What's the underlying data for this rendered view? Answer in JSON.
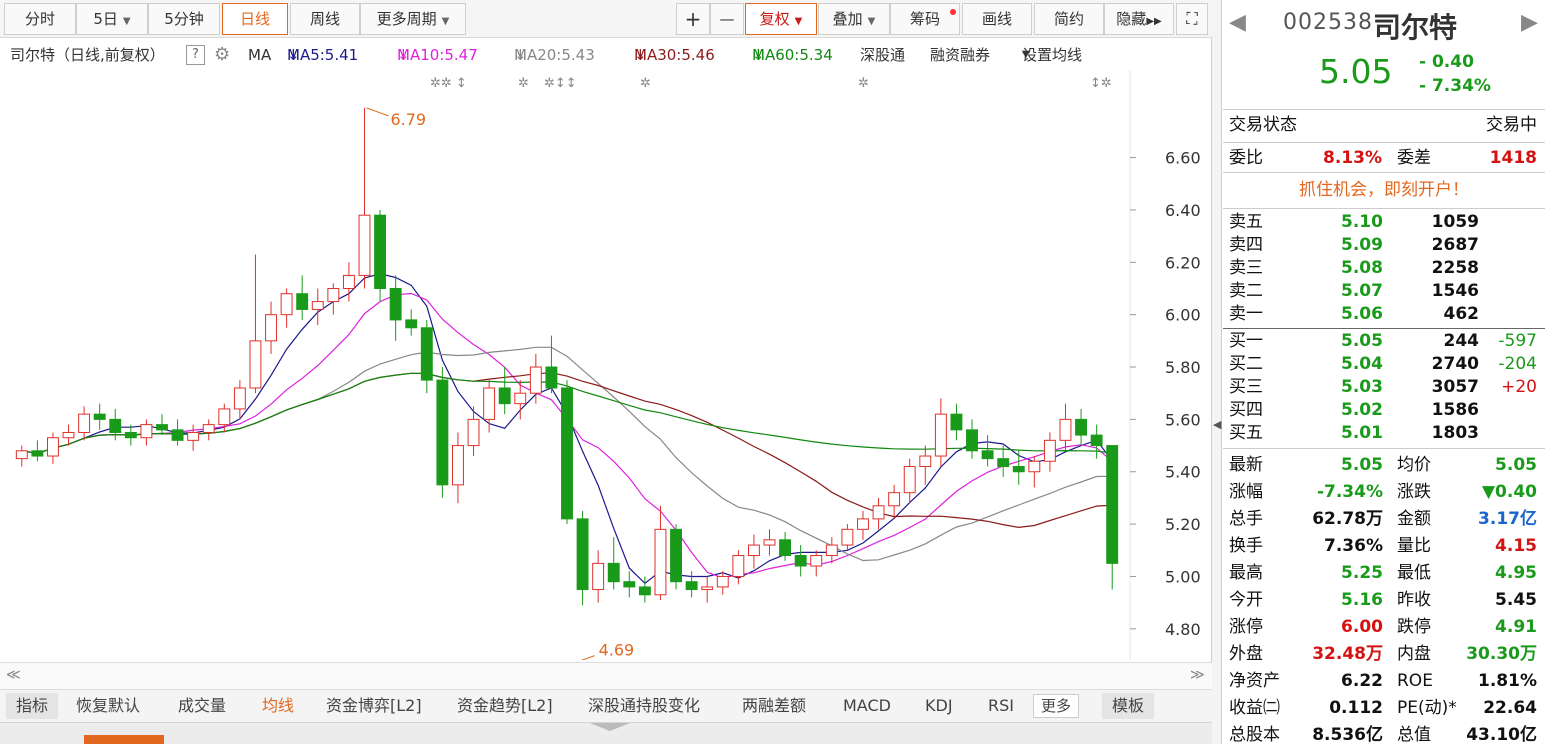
{
  "toolbar": {
    "fenshi": "分时",
    "day5": "5日",
    "min5": "5分钟",
    "rixian": "日线",
    "zhouxian": "周线",
    "more_period": "更多周期",
    "plus": "+",
    "minus": "—",
    "fuquan": "复权",
    "diejia": "叠加",
    "chouma": "筹码",
    "huaxian": "画线",
    "jianyue": "简约",
    "yincang": "隐藏",
    "expand": "⛶"
  },
  "ma_bar": {
    "title": "司尔特（日线,前复权）",
    "help": "?",
    "ma_label": "MA",
    "ma5": "MA5:5.41",
    "ma10": "MA10:5.47",
    "ma20": "MA20:5.43",
    "ma30": "MA30:5.46",
    "ma60": "MA60:5.34",
    "arrow": "↓",
    "shgt": "深股通",
    "rzrq": "融资融券",
    "set_ma": "设置均线",
    "colors": {
      "ma5": "#1a1a8c",
      "ma10": "#dd22dd",
      "ma20": "#888888",
      "ma30": "#8b1a1a",
      "ma60": "#118811"
    }
  },
  "chart_data": {
    "type": "candlestick",
    "y_ticks": [
      "6.60",
      "6.40",
      "6.20",
      "6.00",
      "5.80",
      "5.60",
      "5.40",
      "5.20",
      "5.00",
      "4.80"
    ],
    "ylim": [
      4.7,
      6.82
    ],
    "high_label": "6.79",
    "low_label": "4.69",
    "s_label": "$",
    "annot": [
      "✲✲ ↕",
      "✲",
      "✲↕↕",
      "✲",
      "✲",
      "↕✲"
    ],
    "ohlc": [
      [
        5.45,
        5.5,
        5.42,
        5.48
      ],
      [
        5.48,
        5.52,
        5.44,
        5.46
      ],
      [
        5.46,
        5.55,
        5.43,
        5.53
      ],
      [
        5.53,
        5.58,
        5.5,
        5.55
      ],
      [
        5.55,
        5.65,
        5.52,
        5.62
      ],
      [
        5.62,
        5.66,
        5.56,
        5.6
      ],
      [
        5.6,
        5.64,
        5.52,
        5.55
      ],
      [
        5.55,
        5.58,
        5.5,
        5.53
      ],
      [
        5.53,
        5.6,
        5.5,
        5.58
      ],
      [
        5.58,
        5.62,
        5.54,
        5.56
      ],
      [
        5.56,
        5.6,
        5.5,
        5.52
      ],
      [
        5.52,
        5.58,
        5.48,
        5.55
      ],
      [
        5.55,
        5.6,
        5.52,
        5.58
      ],
      [
        5.58,
        5.66,
        5.55,
        5.64
      ],
      [
        5.64,
        5.75,
        5.6,
        5.72
      ],
      [
        5.72,
        6.23,
        5.7,
        5.9
      ],
      [
        5.9,
        6.05,
        5.85,
        6.0
      ],
      [
        6.0,
        6.1,
        5.95,
        6.08
      ],
      [
        6.08,
        6.15,
        5.98,
        6.02
      ],
      [
        6.02,
        6.1,
        5.96,
        6.05
      ],
      [
        6.05,
        6.12,
        6.0,
        6.1
      ],
      [
        6.1,
        6.2,
        6.05,
        6.15
      ],
      [
        6.15,
        6.79,
        6.1,
        6.38
      ],
      [
        6.38,
        6.4,
        6.05,
        6.1
      ],
      [
        6.1,
        6.15,
        5.9,
        5.98
      ],
      [
        5.98,
        6.02,
        5.92,
        5.95
      ],
      [
        5.95,
        5.98,
        5.7,
        5.75
      ],
      [
        5.75,
        5.8,
        5.3,
        5.35
      ],
      [
        5.35,
        5.55,
        5.28,
        5.5
      ],
      [
        5.5,
        5.65,
        5.46,
        5.6
      ],
      [
        5.6,
        5.75,
        5.55,
        5.72
      ],
      [
        5.72,
        5.8,
        5.62,
        5.66
      ],
      [
        5.66,
        5.75,
        5.6,
        5.7
      ],
      [
        5.7,
        5.85,
        5.66,
        5.8
      ],
      [
        5.8,
        5.92,
        5.7,
        5.72
      ],
      [
        5.72,
        5.75,
        5.2,
        5.22
      ],
      [
        5.22,
        5.25,
        4.89,
        4.95
      ],
      [
        4.95,
        5.1,
        4.9,
        5.05
      ],
      [
        5.05,
        5.15,
        4.95,
        4.98
      ],
      [
        4.98,
        5.02,
        4.92,
        4.96
      ],
      [
        4.96,
        5.0,
        4.9,
        4.93
      ],
      [
        4.93,
        5.27,
        4.91,
        5.18
      ],
      [
        5.18,
        5.2,
        4.95,
        4.98
      ],
      [
        4.98,
        5.02,
        4.92,
        4.95
      ],
      [
        4.95,
        5.0,
        4.9,
        4.96
      ],
      [
        4.96,
        5.02,
        4.93,
        5.0
      ],
      [
        5.0,
        5.1,
        4.97,
        5.08
      ],
      [
        5.08,
        5.16,
        5.03,
        5.12
      ],
      [
        5.12,
        5.18,
        5.08,
        5.14
      ],
      [
        5.14,
        5.17,
        5.06,
        5.08
      ],
      [
        5.08,
        5.12,
        5.0,
        5.04
      ],
      [
        5.04,
        5.1,
        5.0,
        5.08
      ],
      [
        5.08,
        5.15,
        5.05,
        5.12
      ],
      [
        5.12,
        5.2,
        5.1,
        5.18
      ],
      [
        5.18,
        5.25,
        5.14,
        5.22
      ],
      [
        5.22,
        5.3,
        5.18,
        5.27
      ],
      [
        5.27,
        5.35,
        5.22,
        5.32
      ],
      [
        5.32,
        5.45,
        5.28,
        5.42
      ],
      [
        5.42,
        5.5,
        5.35,
        5.46
      ],
      [
        5.46,
        5.68,
        5.42,
        5.62
      ],
      [
        5.62,
        5.66,
        5.52,
        5.56
      ],
      [
        5.56,
        5.6,
        5.45,
        5.48
      ],
      [
        5.48,
        5.54,
        5.42,
        5.45
      ],
      [
        5.45,
        5.5,
        5.38,
        5.42
      ],
      [
        5.42,
        5.48,
        5.35,
        5.4
      ],
      [
        5.4,
        5.46,
        5.34,
        5.44
      ],
      [
        5.44,
        5.55,
        5.4,
        5.52
      ],
      [
        5.52,
        5.66,
        5.48,
        5.6
      ],
      [
        5.6,
        5.64,
        5.5,
        5.54
      ],
      [
        5.54,
        5.58,
        5.45,
        5.5
      ],
      [
        5.5,
        5.25,
        4.95,
        5.05
      ]
    ]
  },
  "scroll": {
    "left": "≪",
    "right": "≫"
  },
  "tabs": {
    "t1": "指标",
    "t2": "恢复默认",
    "t3": "成交量",
    "t4": "均线",
    "t5": "资金博弈[L2]",
    "t6": "资金趋势[L2]",
    "t7": "深股通持股变化",
    "t8": "两融差额",
    "t9": "MACD",
    "t10": "KDJ",
    "t11": "RSI",
    "t12": "更多",
    "t13": "模板"
  },
  "stock": {
    "code": "002538",
    "name": "司尔特",
    "price": "5.05",
    "chg": "- 0.40",
    "pct": "- 7.34%",
    "prev": "◀",
    "next": "▶"
  },
  "status": {
    "label": "交易状态",
    "value": "交易中"
  },
  "weibi": {
    "label": "委比",
    "value": "8.13%",
    "label2": "委差",
    "value2": "1418"
  },
  "promo": "抓住机会，即刻开户！",
  "asks": [
    {
      "label": "卖五",
      "price": "5.10",
      "vol": "1059"
    },
    {
      "label": "卖四",
      "price": "5.09",
      "vol": "2687"
    },
    {
      "label": "卖三",
      "price": "5.08",
      "vol": "2258"
    },
    {
      "label": "卖二",
      "price": "5.07",
      "vol": "1546"
    },
    {
      "label": "卖一",
      "price": "5.06",
      "vol": "462"
    }
  ],
  "bids": [
    {
      "label": "买一",
      "price": "5.05",
      "vol": "244",
      "chg": "-597"
    },
    {
      "label": "买二",
      "price": "5.04",
      "vol": "2740",
      "chg": "-204"
    },
    {
      "label": "买三",
      "price": "5.03",
      "vol": "3057",
      "chg": "+20"
    },
    {
      "label": "买四",
      "price": "5.02",
      "vol": "1586",
      "chg": ""
    },
    {
      "label": "买五",
      "price": "5.01",
      "vol": "1803",
      "chg": ""
    }
  ],
  "stats": [
    {
      "l1": "最新",
      "v1": "5.05",
      "c1": "g",
      "l2": "均价",
      "v2": "5.05",
      "c2": "g"
    },
    {
      "l1": "涨幅",
      "v1": "-7.34%",
      "c1": "g",
      "l2": "涨跌",
      "v2": "▼0.40",
      "c2": "g"
    },
    {
      "l1": "总手",
      "v1": "62.78万",
      "c1": "kb",
      "l2": "金额",
      "v2": "3.17亿",
      "c2": "bl"
    },
    {
      "l1": "换手",
      "v1": "7.36%",
      "c1": "kb",
      "l2": "量比",
      "v2": "4.15",
      "c2": "rd"
    },
    {
      "l1": "最高",
      "v1": "5.25",
      "c1": "g",
      "l2": "最低",
      "v2": "4.95",
      "c2": "g"
    },
    {
      "l1": "今开",
      "v1": "5.16",
      "c1": "g",
      "l2": "昨收",
      "v2": "5.45",
      "c2": "kb"
    },
    {
      "l1": "涨停",
      "v1": "6.00",
      "c1": "rd",
      "l2": "跌停",
      "v2": "4.91",
      "c2": "g"
    },
    {
      "l1": "外盘",
      "v1": "32.48万",
      "c1": "rd",
      "l2": "内盘",
      "v2": "30.30万",
      "c2": "g"
    },
    {
      "l1": "净资产",
      "v1": "6.22",
      "c1": "kb",
      "l2": "ROE",
      "v2": "1.81%",
      "c2": "kb"
    },
    {
      "l1": "收益㈡",
      "v1": "0.112",
      "c1": "kb",
      "l2": "PE(动)*",
      "v2": "22.64",
      "c2": "kb"
    },
    {
      "l1": "总股本",
      "v1": "8.536亿",
      "c1": "kb",
      "l2": "总值",
      "v2": "43.10亿",
      "c2": "kb"
    }
  ]
}
